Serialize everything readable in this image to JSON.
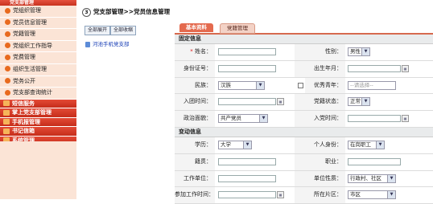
{
  "sidebar": {
    "header": "党支部管理",
    "items": [
      {
        "label": "党组织管理"
      },
      {
        "label": "党员信息管理"
      },
      {
        "label": "党籍管理"
      },
      {
        "label": "党组织工作指导"
      },
      {
        "label": "党费管理"
      },
      {
        "label": "组织生活管理"
      },
      {
        "label": "党务公开"
      },
      {
        "label": "党支部查询统计"
      }
    ],
    "sections": [
      {
        "label": "短信服务"
      },
      {
        "label": "掌上党支部管理"
      },
      {
        "label": "手机报管理"
      },
      {
        "label": "书记信箱"
      },
      {
        "label": "系统管理"
      }
    ]
  },
  "breadcrumb": {
    "text": "党支部管理>>党员信息管理"
  },
  "tree": {
    "expand_all": "全部展开",
    "collapse_all": "全部收缩",
    "node": "河池手机党支部"
  },
  "tabs": {
    "basic": "基本资料",
    "roster": "党籍管理"
  },
  "form": {
    "section_fixed": "固定信息",
    "section_changing": "变动信息",
    "name_label": "姓名：",
    "required_mark": "*",
    "gender_label": "性别：",
    "gender_value": "男性",
    "id_label": "身份证号：",
    "birth_label": "出生年月：",
    "nation_label": "民族：",
    "nation_value": "汉族",
    "excellent_label": "优秀青年：",
    "excellent_placeholder": "--请选择--",
    "join_label": "入团时间：",
    "status_label": "党籍状态：",
    "status_value": "正常",
    "political_label": "政治面貌：",
    "political_value": "共产党员",
    "party_join_label": "入党时间：",
    "edu_label": "学历：",
    "edu_value": "大学",
    "identity_label": "个人身份：",
    "identity_value": "在岗职工",
    "origin_label": "籍贯：",
    "job_label": "职业：",
    "workplace_label": "工作单位：",
    "unit_type_label": "单位性质：",
    "unit_type_value": "行政村、社区",
    "work_start_label": "参加工作时间：",
    "area_label": "所在片区：",
    "area_value": "市区"
  }
}
